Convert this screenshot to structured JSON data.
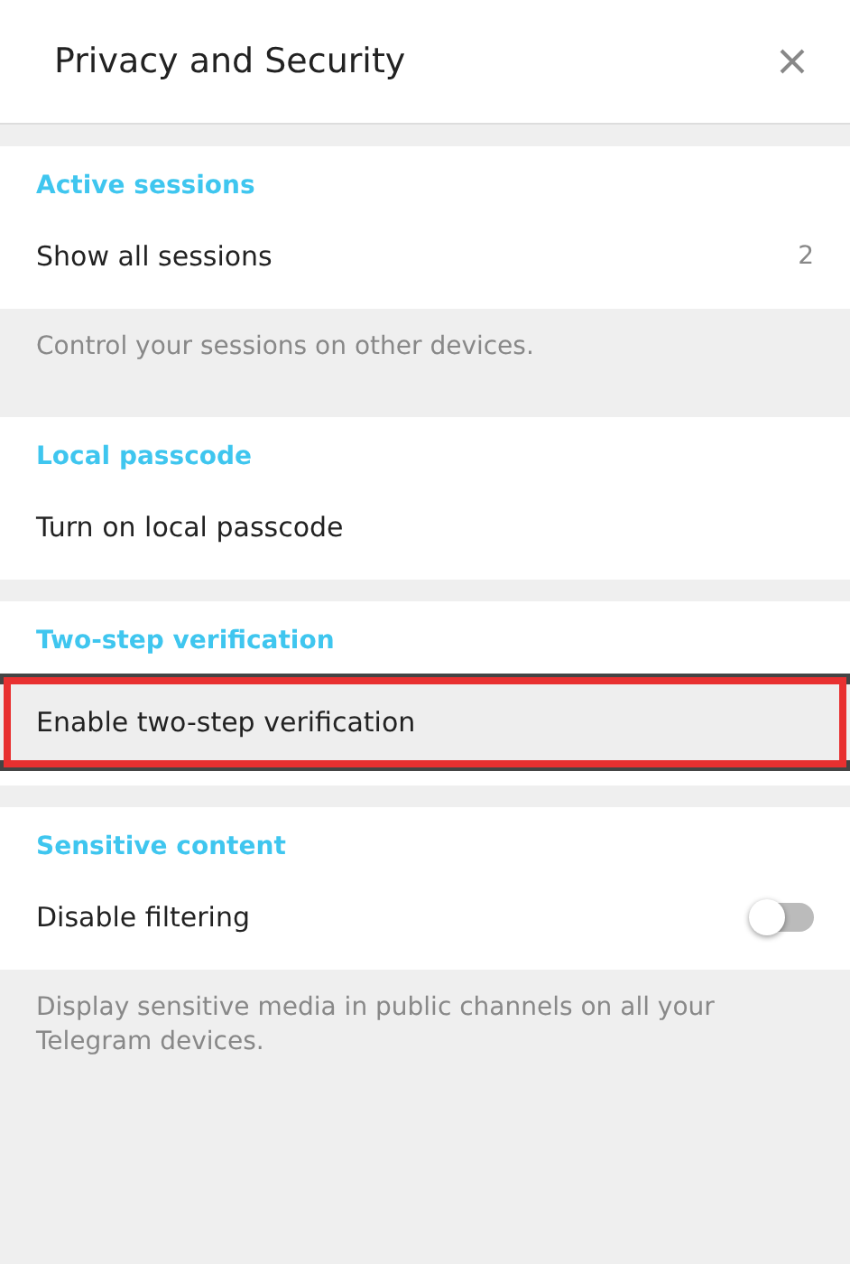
{
  "window": {
    "title": "Privacy and Security"
  },
  "sections": [
    {
      "header": "Active sessions",
      "rows": [
        {
          "label": "Show all sessions",
          "count": "2",
          "kind": "link",
          "highlighted": false
        }
      ],
      "note": "Control your sessions on other devices."
    },
    {
      "header": "Local passcode",
      "rows": [
        {
          "label": "Turn on local passcode",
          "kind": "link",
          "highlighted": false
        }
      ]
    },
    {
      "header": "Two-step verification",
      "rows": [
        {
          "label": "Enable two-step verification",
          "kind": "link",
          "highlighted": true
        }
      ]
    },
    {
      "header": "Sensitive content",
      "rows": [
        {
          "label": "Disable filtering",
          "kind": "toggle",
          "on": false,
          "highlighted": false
        }
      ],
      "note": "Display sensitive media in public channels on all your Telegram devices."
    }
  ]
}
